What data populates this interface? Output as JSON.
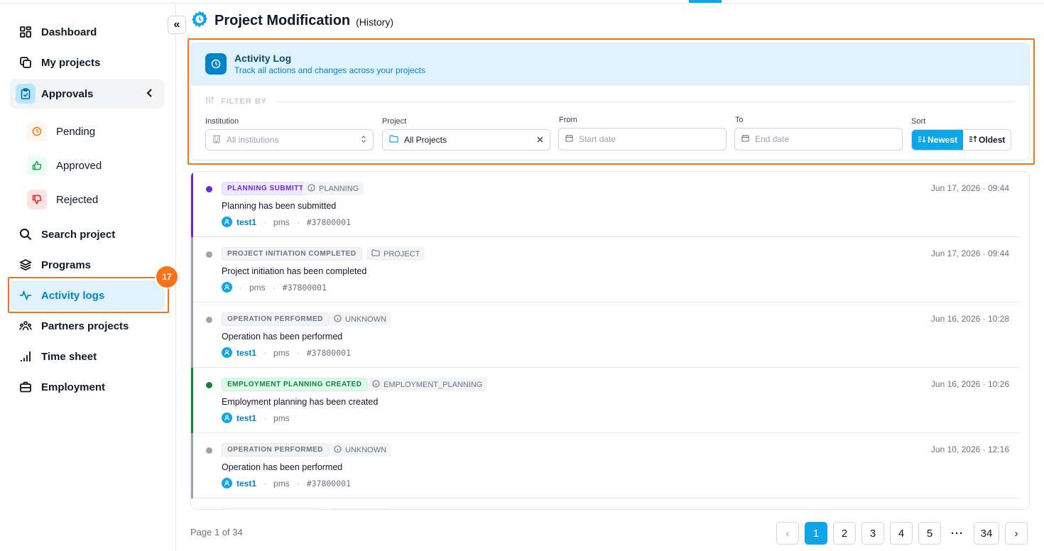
{
  "sidebar": {
    "items": [
      {
        "label": "Dashboard",
        "icon": "dashboard-icon"
      },
      {
        "label": "My projects",
        "icon": "copy-icon"
      },
      {
        "label": "Approvals",
        "icon": "clipboard-check-icon"
      },
      {
        "label": "Search project",
        "icon": "search-icon"
      },
      {
        "label": "Programs",
        "icon": "layers-icon"
      },
      {
        "label": "Activity logs",
        "icon": "activity-icon"
      },
      {
        "label": "Partners projects",
        "icon": "users-icon"
      },
      {
        "label": "Time sheet",
        "icon": "bar-chart-icon"
      },
      {
        "label": "Employment",
        "icon": "briefcase-icon"
      }
    ],
    "approvals_sub": [
      {
        "label": "Pending",
        "icon": "clock-icon"
      },
      {
        "label": "Approved",
        "icon": "thumbs-up-icon"
      },
      {
        "label": "Rejected",
        "icon": "thumbs-down-icon"
      }
    ],
    "step_badge": "17",
    "collapse_glyph": "«"
  },
  "header": {
    "title": "Project Modification",
    "subtitle": "(History)"
  },
  "activity": {
    "title": "Activity Log",
    "subtitle": "Track all actions and changes across your projects",
    "filter_by": "FILTER BY",
    "fields": {
      "institution_label": "Institution",
      "institution_placeholder": "All institutions",
      "project_label": "Project",
      "project_value": "All Projects",
      "from_label": "From",
      "from_placeholder": "Start date",
      "to_label": "To",
      "to_placeholder": "End date",
      "sort_label": "Sort",
      "sort_newest": "Newest",
      "sort_oldest": "Oldest"
    }
  },
  "logs": [
    {
      "tag": "PLANNING SUBMITTED",
      "category": "PLANNING",
      "category_icon": "info-icon",
      "message": "Planning has been submitted",
      "user": "test1",
      "source": "pms",
      "ref": "#37800001",
      "time": "Jun 17, 2026 · 09:44",
      "color": "#6d28d9"
    },
    {
      "tag": "PROJECT INITIATION COMPLETED",
      "category": "PROJECT",
      "category_icon": "folder-icon",
      "message": "Project initiation has been completed",
      "user": "",
      "source": "pms",
      "ref": "#37800001",
      "time": "Jun 17, 2026 · 09:44",
      "color": "#6b7280"
    },
    {
      "tag": "OPERATION PERFORMED",
      "category": "UNKNOWN",
      "category_icon": "info-icon",
      "message": "Operation has been performed",
      "user": "test1",
      "source": "pms",
      "ref": "#37800001",
      "time": "Jun 16, 2026 · 10:28",
      "color": "#6b7280"
    },
    {
      "tag": "EMPLOYMENT PLANNING CREATED",
      "category": "EMPLOYMENT_PLANNING",
      "category_icon": "info-icon",
      "message": "Employment planning has been created",
      "user": "test1",
      "source": "pms",
      "ref": "",
      "time": "Jun 16, 2026 · 10:26",
      "color": "#15803d"
    },
    {
      "tag": "OPERATION PERFORMED",
      "category": "UNKNOWN",
      "category_icon": "info-icon",
      "message": "Operation has been performed",
      "user": "test1",
      "source": "pms",
      "ref": "#37800001",
      "time": "Jun 10, 2026 · 12:16",
      "color": "#6b7280"
    }
  ],
  "pagination": {
    "info": "Page 1 of 34",
    "pages": [
      "1",
      "2",
      "3",
      "4",
      "5",
      "···",
      "34"
    ],
    "current": "1",
    "prev": "‹",
    "next": "›"
  },
  "colors": {
    "accent": "#0ea5e9",
    "highlight": "#f97316",
    "purple": "#6d28d9",
    "green": "#15803d",
    "gray": "#6b7280"
  }
}
